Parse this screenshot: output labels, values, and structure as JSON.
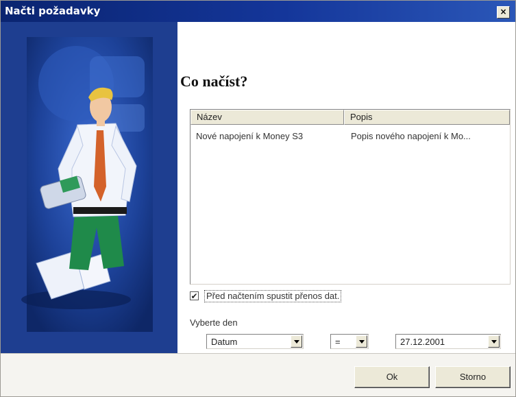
{
  "window": {
    "title": "Načti požadavky",
    "close_label": "×"
  },
  "heading": "Co načíst?",
  "list": {
    "columns": [
      "Název",
      "Popis"
    ],
    "rows": [
      {
        "name": "Nové napojení k Money S3",
        "description": "Popis nového napojení k Mo..."
      }
    ]
  },
  "options": {
    "checkbox_label": "Před načtením spustit přenos dat.",
    "checked": true,
    "check_glyph": "✔"
  },
  "day": {
    "label": "Vyberte den",
    "type_value": "Datum",
    "operator_value": "=",
    "date_value": "27.12.2001"
  },
  "buttons": {
    "ok": "Ok",
    "cancel": "Storno"
  },
  "colors": {
    "titlebar": "#0a2470",
    "panel": "#1a3a8c",
    "window_bg": "#f5f4f0"
  }
}
